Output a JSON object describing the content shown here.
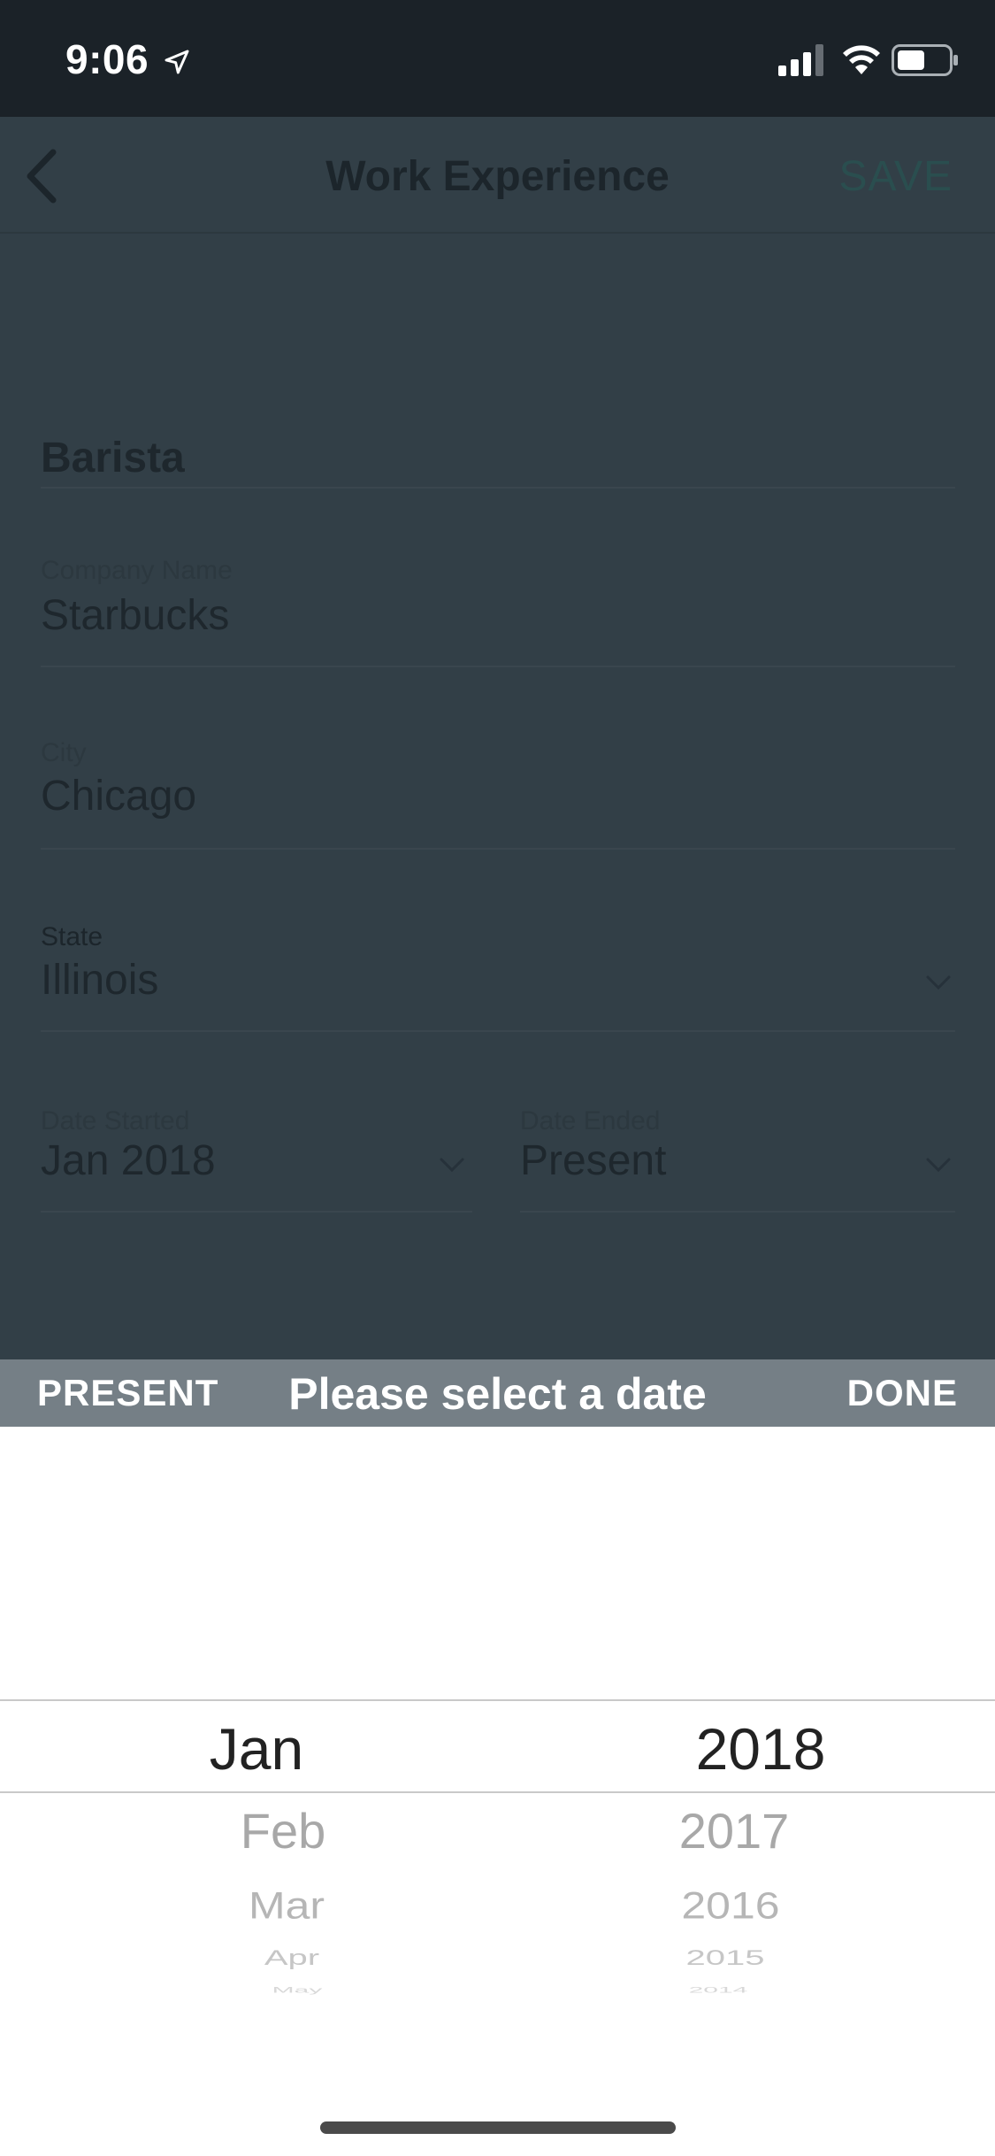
{
  "status_bar": {
    "time": "9:06",
    "icons": [
      "location-arrow-icon",
      "signal-icon",
      "wifi-icon",
      "battery-icon"
    ]
  },
  "nav": {
    "title": "Work Experience",
    "save_label": "SAVE",
    "back_icon": "chevron-left-icon"
  },
  "form": {
    "job_title": "Barista",
    "company": {
      "label": "Company Name",
      "value": "Starbucks"
    },
    "city": {
      "label": "City",
      "value": "Chicago"
    },
    "state": {
      "label": "State",
      "value": "Illinois"
    },
    "date_started": {
      "label": "Date Started",
      "value": "Jan 2018"
    },
    "date_ended": {
      "label": "Date Ended",
      "value": "Present"
    }
  },
  "picker_toolbar": {
    "present_label": "PRESENT",
    "title": "Please select a date",
    "done_label": "DONE"
  },
  "picker": {
    "months": [
      "Jan",
      "Feb",
      "Mar",
      "Apr",
      "May"
    ],
    "years": [
      "2018",
      "2017",
      "2016",
      "2015",
      "2014"
    ],
    "selected_month": "Jan",
    "selected_year": "2018"
  },
  "colors": {
    "status_bar": "#1b2228",
    "overlay": "#323f47",
    "toolbar": "#757f86",
    "save_accent": "#2a4e4f"
  }
}
